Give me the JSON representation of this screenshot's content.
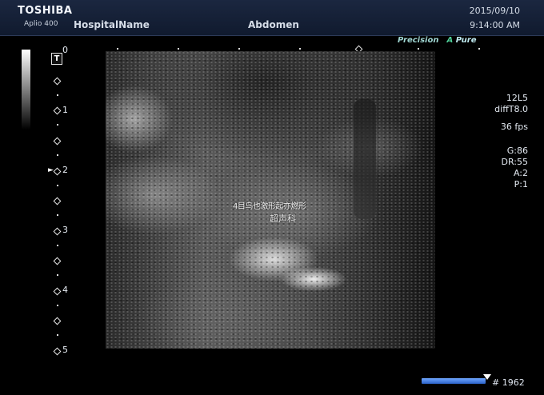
{
  "header": {
    "brand": "TOSHIBA",
    "model": "Aplio 400",
    "hospital": "HospitalName",
    "region": "Abdomen",
    "date": "2015/09/10",
    "time": "9:14:00 AM"
  },
  "mode_label": {
    "precision": "Precision",
    "a": "A",
    "pure": "Pure"
  },
  "tgc_label": "T",
  "depth_scale": {
    "labels": [
      "0",
      "1",
      "2",
      "3",
      "4",
      "5"
    ]
  },
  "image_overlay": {
    "text1": "4目鸟也激形起亦燃形",
    "text2": "超声科"
  },
  "params": {
    "probe": "12L5",
    "preset": "diffT8.0",
    "fps": "36 fps",
    "gain": "G:86",
    "dynamic_range": "DR:55",
    "a": "A:2",
    "p": "P:1"
  },
  "frame_counter": "# 1962"
}
